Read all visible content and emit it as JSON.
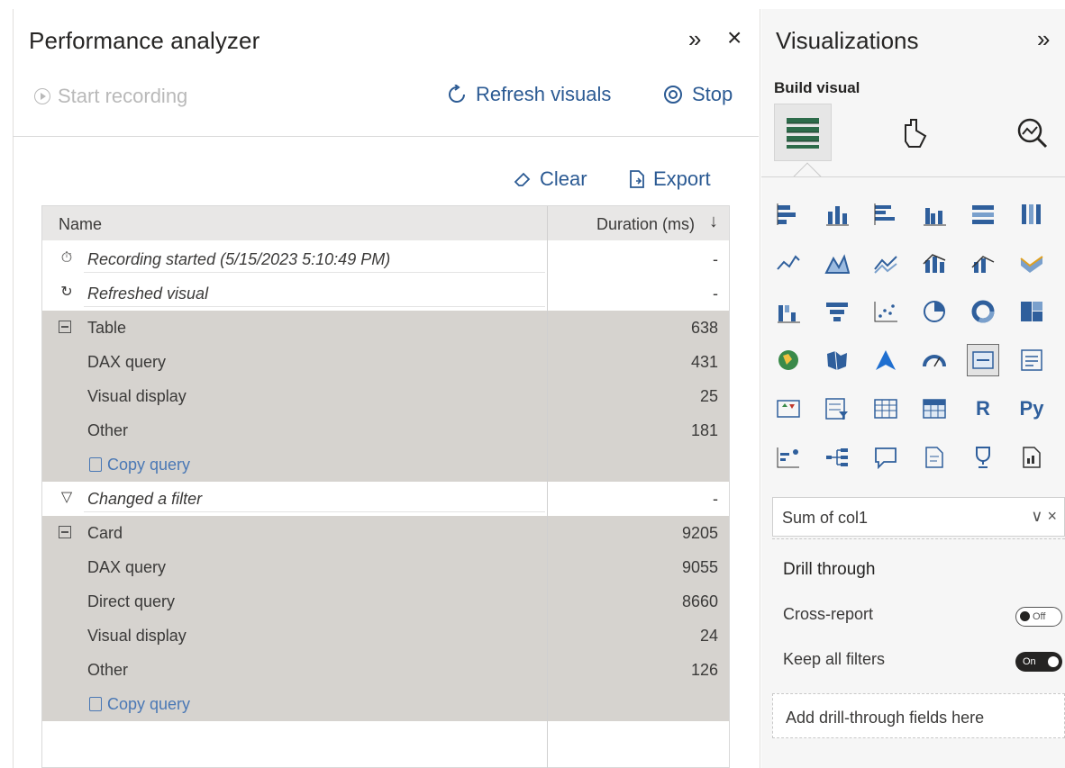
{
  "performance_analyzer": {
    "title": "Performance analyzer",
    "start_recording": "Start recording",
    "refresh_visuals": "Refresh visuals",
    "stop": "Stop",
    "clear": "Clear",
    "export": "Export",
    "columns": {
      "name": "Name",
      "duration": "Duration (ms)"
    },
    "rows": [
      {
        "icon": "stopwatch-icon",
        "name": "Recording started (5/15/2023 5:10:49 PM)",
        "duration": "-",
        "style": "event"
      },
      {
        "icon": "refresh-icon",
        "name": "Refreshed visual",
        "duration": "-",
        "style": "event"
      },
      {
        "icon": "collapse-icon",
        "name": "Table",
        "duration": "638",
        "style": "group"
      },
      {
        "name": "DAX query",
        "duration": "431",
        "style": "sub"
      },
      {
        "name": "Visual display",
        "duration": "25",
        "style": "sub"
      },
      {
        "name": "Other",
        "duration": "181",
        "style": "sub"
      },
      {
        "name": "Copy query",
        "duration": "",
        "style": "copy"
      },
      {
        "icon": "filter-icon",
        "name": "Changed a filter",
        "duration": "-",
        "style": "event"
      },
      {
        "icon": "collapse-icon",
        "name": "Card",
        "duration": "9205",
        "style": "group"
      },
      {
        "name": "DAX query",
        "duration": "9055",
        "style": "sub"
      },
      {
        "name": "Direct query",
        "duration": "8660",
        "style": "sub"
      },
      {
        "name": "Visual display",
        "duration": "24",
        "style": "sub"
      },
      {
        "name": "Other",
        "duration": "126",
        "style": "sub"
      },
      {
        "name": "Copy query",
        "duration": "",
        "style": "copy"
      }
    ]
  },
  "visualizations": {
    "title": "Visualizations",
    "build_visual": "Build visual",
    "field_well": "Sum of col1",
    "drill_through": "Drill through",
    "cross_report": {
      "label": "Cross-report",
      "state": "Off"
    },
    "keep_all_filters": {
      "label": "Keep all filters",
      "state": "On"
    },
    "add_drill_fields": "Add drill-through fields here",
    "text_icons": {
      "r": "R",
      "py": "Py"
    }
  }
}
